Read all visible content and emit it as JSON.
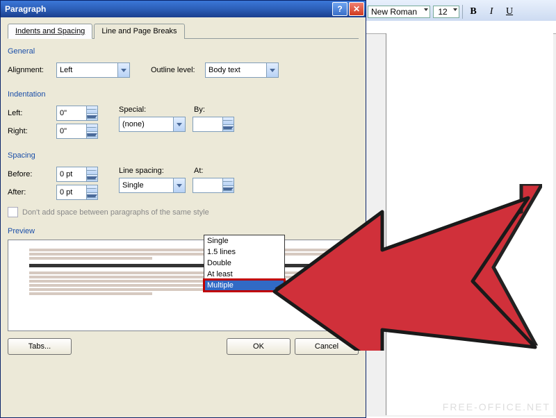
{
  "toolbar": {
    "font": "New Roman",
    "size": "12",
    "bold": "B",
    "italic": "I",
    "underline": "U"
  },
  "dialog": {
    "title": "Paragraph",
    "tabs": [
      "Indents and Spacing",
      "Line and Page Breaks"
    ],
    "general": {
      "title": "General",
      "alignment_label": "Alignment:",
      "alignment_value": "Left",
      "outline_label": "Outline level:",
      "outline_value": "Body text"
    },
    "indent": {
      "title": "Indentation",
      "left_label": "Left:",
      "left_value": "0\"",
      "right_label": "Right:",
      "right_value": "0\"",
      "special_label": "Special:",
      "special_value": "(none)",
      "by_label": "By:",
      "by_value": ""
    },
    "spacing": {
      "title": "Spacing",
      "before_label": "Before:",
      "before_value": "0 pt",
      "after_label": "After:",
      "after_value": "0 pt",
      "line_label": "Line spacing:",
      "line_value": "Single",
      "at_label": "At:",
      "at_value": "",
      "checkbox": "Don't add space between paragraphs of the same style"
    },
    "line_options": [
      "Single",
      "1.5 lines",
      "Double",
      "At least",
      "Multiple"
    ],
    "preview_title": "Preview",
    "buttons": {
      "tabs": "Tabs...",
      "ok": "OK",
      "cancel": "Cancel"
    }
  },
  "watermark": "FREE-OFFICE.NET"
}
